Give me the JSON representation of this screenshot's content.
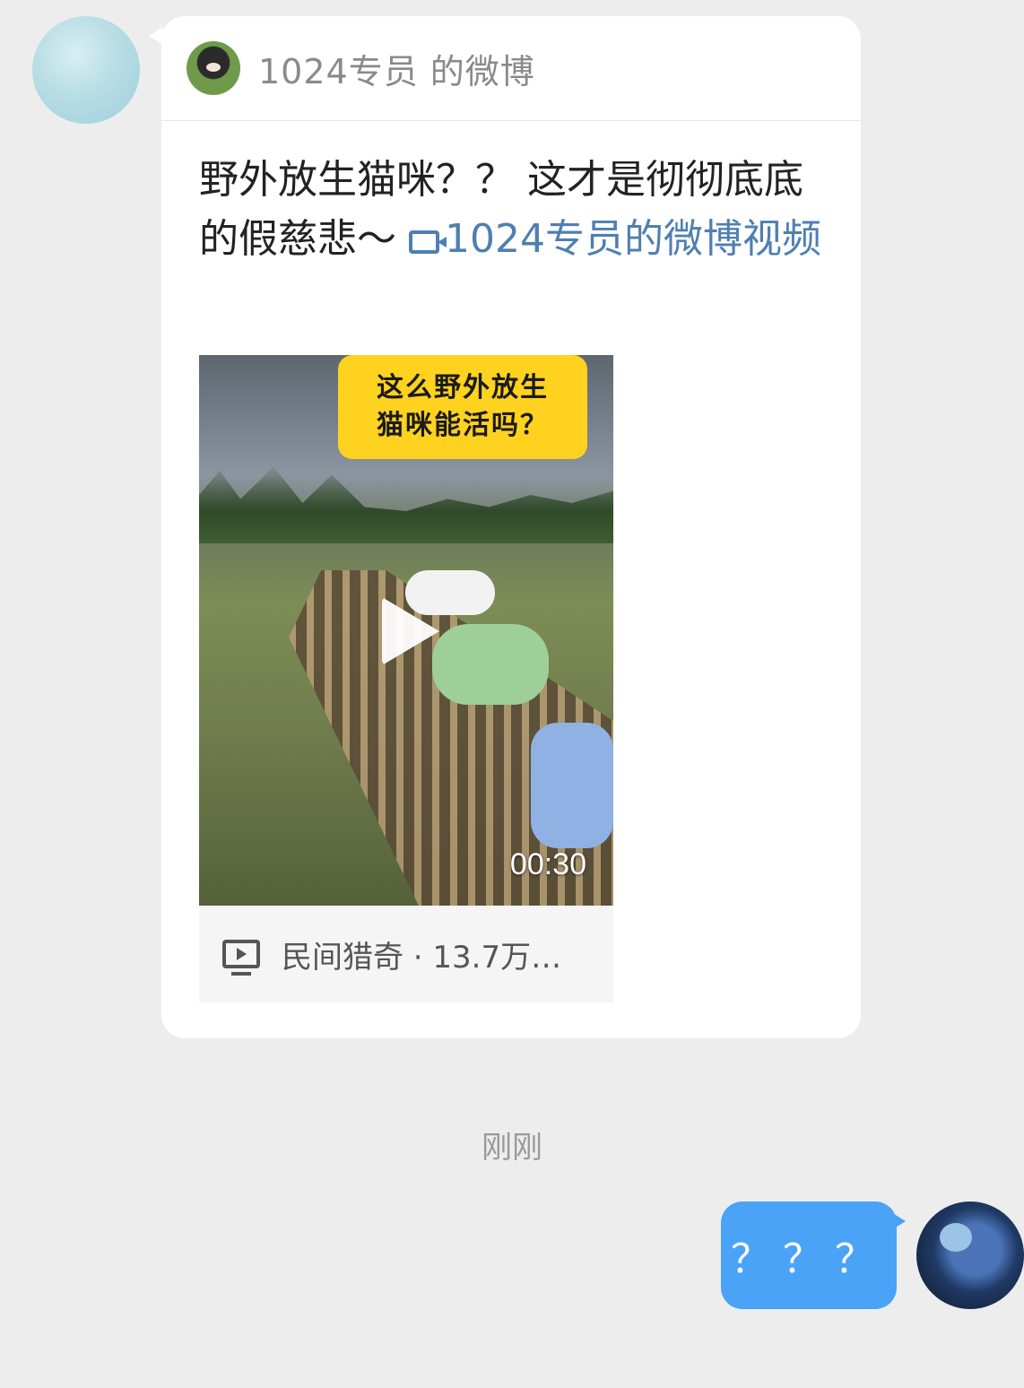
{
  "conversation": {
    "shared_card": {
      "header_title": "1024专员 的微博",
      "post_text": "野外放生猫咪？？ 这才是彻彻底底的假慈悲～ ",
      "post_link": "1024专员的微博视频",
      "video": {
        "overlay_line1": "这么野外放生",
        "overlay_line2": "猫咪能活吗？",
        "duration": "00:30",
        "meta": "民间猎奇 · 13.7万…"
      }
    },
    "timestamp": "刚刚",
    "reply_message": "？？？"
  },
  "icons": {
    "header_avatar": "bear-mascot-avatar",
    "video_link": "video-camera-icon",
    "play": "play-icon",
    "meta": "video-play-box-icon"
  },
  "colors": {
    "link": "#4f7fb1",
    "bubble_blue": "#4aa3f7",
    "background": "#ededed",
    "caption_yellow": "#ffd21f"
  }
}
